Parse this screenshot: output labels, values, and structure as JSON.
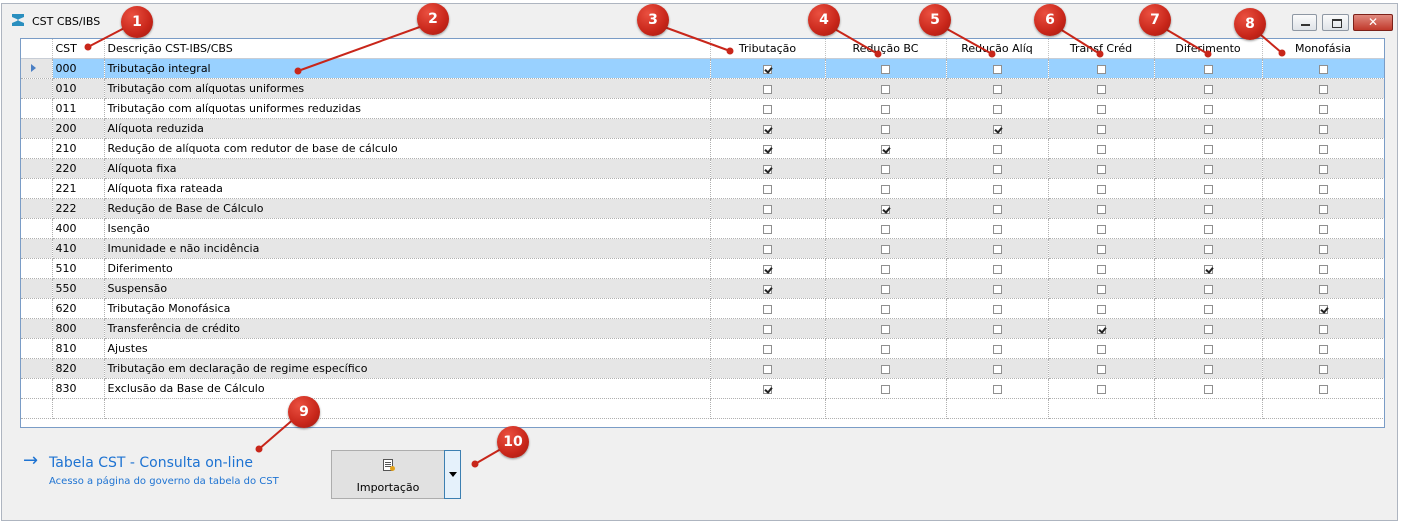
{
  "window": {
    "title": "CST CBS/IBS",
    "close_label": "✕"
  },
  "columns": [
    "CST",
    "Descrição CST-IBS/CBS",
    "Tributação",
    "Redução BC",
    "Redução Alíq",
    "Transf Créd",
    "Diferimento",
    "Monofásia"
  ],
  "rows": [
    {
      "cst": "000",
      "desc": "Tributação integral",
      "flags": [
        true,
        false,
        false,
        false,
        false,
        false
      ],
      "selected": true
    },
    {
      "cst": "010",
      "desc": "Tributação com alíquotas uniformes",
      "flags": [
        false,
        false,
        false,
        false,
        false,
        false
      ]
    },
    {
      "cst": "011",
      "desc": "Tributação com alíquotas uniformes reduzidas",
      "flags": [
        false,
        false,
        false,
        false,
        false,
        false
      ]
    },
    {
      "cst": "200",
      "desc": "Alíquota reduzida",
      "flags": [
        true,
        false,
        true,
        false,
        false,
        false
      ]
    },
    {
      "cst": "210",
      "desc": "Redução de alíquota com redutor de base de cálculo",
      "flags": [
        true,
        true,
        false,
        false,
        false,
        false
      ]
    },
    {
      "cst": "220",
      "desc": "Alíquota fixa",
      "flags": [
        true,
        false,
        false,
        false,
        false,
        false
      ]
    },
    {
      "cst": "221",
      "desc": "Alíquota fixa rateada",
      "flags": [
        false,
        false,
        false,
        false,
        false,
        false
      ]
    },
    {
      "cst": "222",
      "desc": "Redução de Base de Cálculo",
      "flags": [
        false,
        true,
        false,
        false,
        false,
        false
      ]
    },
    {
      "cst": "400",
      "desc": "Isenção",
      "flags": [
        false,
        false,
        false,
        false,
        false,
        false
      ]
    },
    {
      "cst": "410",
      "desc": "Imunidade e não incidência",
      "flags": [
        false,
        false,
        false,
        false,
        false,
        false
      ]
    },
    {
      "cst": "510",
      "desc": "Diferimento",
      "flags": [
        true,
        false,
        false,
        false,
        true,
        false
      ]
    },
    {
      "cst": "550",
      "desc": "Suspensão",
      "flags": [
        true,
        false,
        false,
        false,
        false,
        false
      ]
    },
    {
      "cst": "620",
      "desc": "Tributação Monofásica",
      "flags": [
        false,
        false,
        false,
        false,
        false,
        true
      ]
    },
    {
      "cst": "800",
      "desc": "Transferência de crédito",
      "flags": [
        false,
        false,
        false,
        true,
        false,
        false
      ]
    },
    {
      "cst": "810",
      "desc": "Ajustes",
      "flags": [
        false,
        false,
        false,
        false,
        false,
        false
      ]
    },
    {
      "cst": "820",
      "desc": "Tributação em declaração de regime específico",
      "flags": [
        false,
        false,
        false,
        false,
        false,
        false
      ]
    },
    {
      "cst": "830",
      "desc": "Exclusão da Base de Cálculo",
      "flags": [
        true,
        false,
        false,
        false,
        false,
        false
      ]
    }
  ],
  "link": {
    "arrow": "→",
    "title": "Tabela CST - Consulta on-line",
    "subtitle": "Acesso a página do governo da tabela do CST"
  },
  "import_button": {
    "label": "Importação"
  },
  "markers": [
    "1",
    "2",
    "3",
    "4",
    "5",
    "6",
    "7",
    "8",
    "9",
    "10"
  ],
  "colors": {
    "selection": "#99d1ff",
    "alt_row": "#e6e6e6",
    "link": "#1e73d2",
    "marker": "#c8261a"
  }
}
